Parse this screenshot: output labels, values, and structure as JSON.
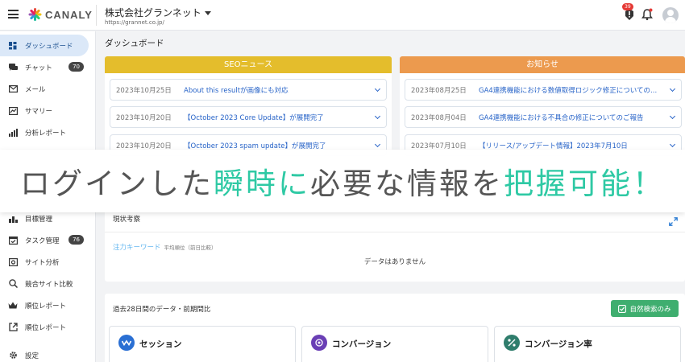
{
  "header": {
    "logo_text": "CANALY",
    "company_name": "株式会社グランネット",
    "company_url": "https://grannet.co.jp/",
    "notification_count": "39"
  },
  "sidebar": {
    "items": [
      {
        "label": "ダッシュボード",
        "icon": "dashboard-icon"
      },
      {
        "label": "チャット",
        "icon": "chat-icon",
        "count": "70"
      },
      {
        "label": "メール",
        "icon": "mail-icon"
      },
      {
        "label": "サマリー",
        "icon": "summary-icon"
      },
      {
        "label": "分析レポート",
        "icon": "report-icon"
      },
      {
        "label": "目標管理",
        "icon": "goal-icon"
      },
      {
        "label": "タスク管理",
        "icon": "task-icon",
        "count": "76"
      },
      {
        "label": "サイト分析",
        "icon": "site-analysis-icon"
      },
      {
        "label": "競合サイト比較",
        "icon": "competitor-icon"
      },
      {
        "label": "順位レポート",
        "icon": "crown-icon"
      },
      {
        "label": "順位レポート",
        "icon": "external-link-icon"
      },
      {
        "label": "設定",
        "icon": "gear-icon"
      }
    ]
  },
  "main": {
    "page_title": "ダッシュボード",
    "seo_panel": {
      "title": "SEOニュース",
      "color": "#e4bd2c",
      "items": [
        {
          "date": "2023年10月25日",
          "title": "About this resultが画像にも対応"
        },
        {
          "date": "2023年10月20日",
          "title": "【October 2023 Core Update】が展開完了"
        },
        {
          "date": "2023年10月20日",
          "title": "【October 2023 spam update】が展開完了"
        }
      ]
    },
    "notice_panel": {
      "title": "お知らせ",
      "color": "#ec9a4e",
      "items": [
        {
          "date": "2023年08月25日",
          "title": "GA4連携機能における数値取得ロジック修正についての..."
        },
        {
          "date": "2023年08月04日",
          "title": "GA4連携機能における不具合の修正についてのご報告"
        },
        {
          "date": "2023年07月10日",
          "title": "【リリース/アップデート情報】2023年7月10日"
        }
      ]
    },
    "banner": {
      "part1": "ログインした",
      "part2": "瞬時に",
      "part3": "必要な情報を",
      "part4": "把握可能！",
      "highlight_color": "#2ec9a4"
    },
    "status_panel": {
      "title": "現状考察",
      "focus_label": "注力キーワード",
      "focus_sub": "平均順位（前日比較）",
      "no_data": "データはありません"
    },
    "bottom_panel": {
      "title": "過去28日間のデータ・前期間比",
      "button_label": "自然検索のみ",
      "metrics": [
        {
          "label": "セッション",
          "color": "#2a6fd3",
          "icon": "wave-icon"
        },
        {
          "label": "コンバージョン",
          "color": "#6a3fb5",
          "icon": "target-icon"
        },
        {
          "label": "コンバージョン率",
          "color": "#2f7d6c",
          "icon": "percent-icon"
        }
      ]
    }
  }
}
